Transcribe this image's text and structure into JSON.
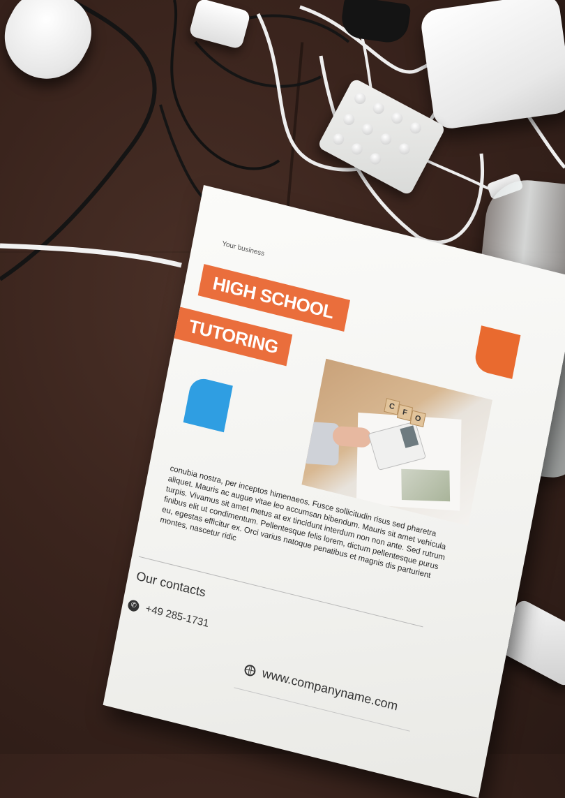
{
  "flyer": {
    "business_label": "Your business",
    "title_line_1": "HIGH SCHOOL",
    "title_line_2": "TUTORING",
    "photo_blocks": [
      "C",
      "F",
      "O"
    ],
    "body_text": "conubia nostra, per inceptos himenaeos. Fusce sollicitudin risus sed pharetra aliquet. Mauris ac augue vitae leo accumsan bibendum. Mauris sit amet vehicula turpis. Vivamus sit amet metus at ex tincidunt interdum non non ante. Sed rutrum finibus elit ut condimentum. Pellentesque felis lorem, dictum pellentesque purus eu, egestas efficitur ex. Orci varius natoque penatibus et magnis dis parturient montes, nascetur ridic",
    "contacts_heading": "Our contacts",
    "phone": "+49 285-1731",
    "website": "www.companyname.com"
  },
  "colors": {
    "accent_orange": "#ea6e3c",
    "accent_blue": "#2f9ee2",
    "desk": "#3a241d"
  },
  "icons": {
    "phone": "phone-icon",
    "globe": "globe-icon"
  }
}
